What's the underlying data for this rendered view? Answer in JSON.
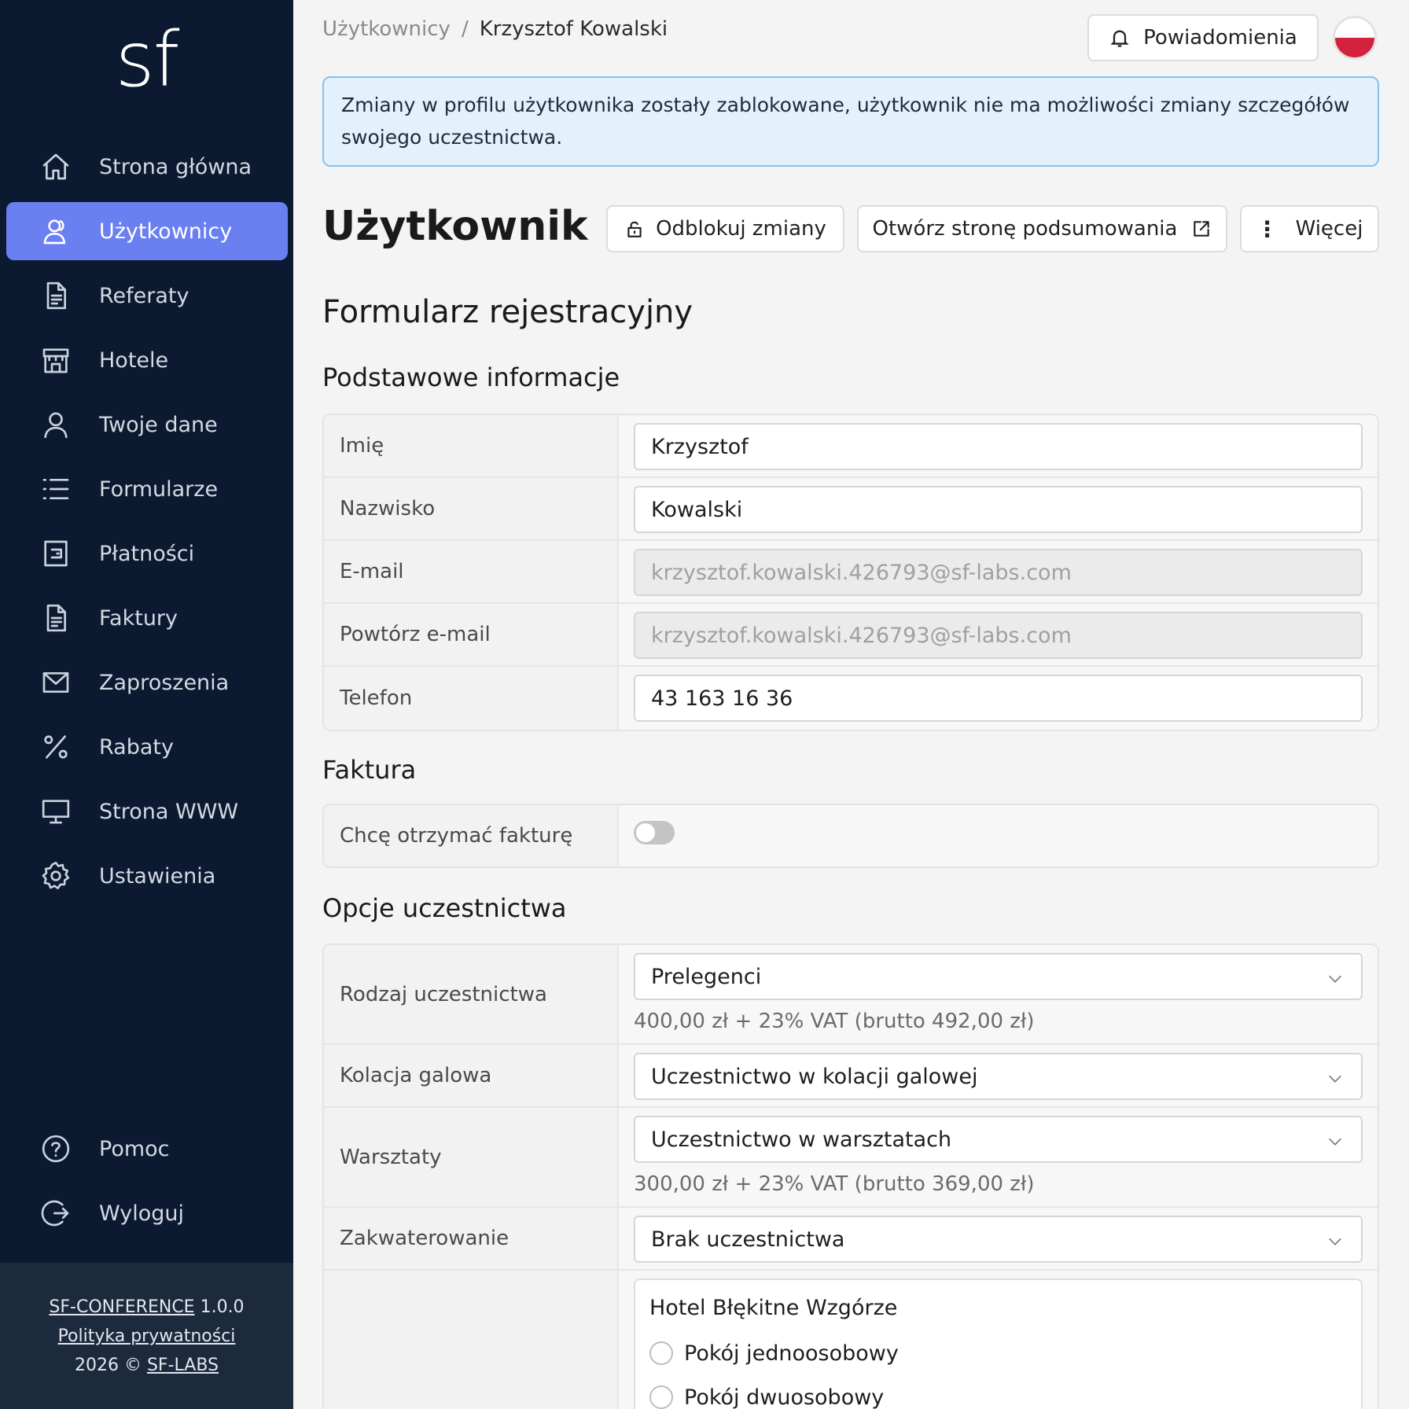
{
  "sidebar": {
    "logo": "sf",
    "items": [
      {
        "label": "Strona główna",
        "icon": "home-icon"
      },
      {
        "label": "Użytkownicy",
        "icon": "users-icon",
        "active": true
      },
      {
        "label": "Referaty",
        "icon": "document-icon"
      },
      {
        "label": "Hotele",
        "icon": "hotel-icon"
      },
      {
        "label": "Twoje dane",
        "icon": "user-icon"
      },
      {
        "label": "Formularze",
        "icon": "list-icon"
      },
      {
        "label": "Płatności",
        "icon": "wallet-icon"
      },
      {
        "label": "Faktury",
        "icon": "invoice-icon"
      },
      {
        "label": "Zaproszenia",
        "icon": "mail-icon"
      },
      {
        "label": "Rabaty",
        "icon": "percent-icon"
      },
      {
        "label": "Strona WWW",
        "icon": "monitor-icon"
      },
      {
        "label": "Ustawienia",
        "icon": "gear-icon"
      }
    ],
    "bottom": [
      {
        "label": "Pomoc",
        "icon": "help-icon"
      },
      {
        "label": "Wyloguj",
        "icon": "logout-icon"
      }
    ],
    "footer": {
      "product": "SF-CONFERENCE",
      "version": "1.0.0",
      "privacy": "Polityka prywatności",
      "copyright": "2026 ©",
      "company": "SF-LABS"
    }
  },
  "header": {
    "breadcrumb": {
      "parent": "Użytkownicy",
      "separator": "/",
      "current": "Krzysztof Kowalski"
    },
    "notifications_label": "Powiadomienia",
    "language": "pl"
  },
  "alert": "Zmiany w profilu użytkownika zostały zablokowane, użytkownik nie ma możliwości zmiany szczegółów swojego uczestnictwa.",
  "page": {
    "title": "Użytkownik",
    "unlock_label": "Odblokuj zmiany",
    "open_summary_label": "Otwórz stronę podsumowania",
    "more_label": "Więcej",
    "form_title": "Formularz rejestracyjny"
  },
  "basic": {
    "title": "Podstawowe informacje",
    "first_name": {
      "label": "Imię",
      "value": "Krzysztof"
    },
    "last_name": {
      "label": "Nazwisko",
      "value": "Kowalski"
    },
    "email": {
      "label": "E-mail",
      "value": "krzysztof.kowalski.426793@sf-labs.com"
    },
    "email_repeat": {
      "label": "Powtórz e-mail",
      "value": "krzysztof.kowalski.426793@sf-labs.com"
    },
    "phone": {
      "label": "Telefon",
      "value": "43 163 16 36"
    }
  },
  "invoice": {
    "title": "Faktura",
    "want_invoice": {
      "label": "Chcę otrzymać fakturę",
      "value": false
    }
  },
  "participation": {
    "title": "Opcje uczestnictwa",
    "type": {
      "label": "Rodzaj uczestnictwa",
      "value": "Prelegenci",
      "price": "400,00 zł + 23% VAT (brutto 492,00 zł)"
    },
    "gala": {
      "label": "Kolacja galowa",
      "value": "Uczestnictwo w kolacji galowej"
    },
    "workshops": {
      "label": "Warsztaty",
      "value": "Uczestnictwo w warsztatach",
      "price": "300,00 zł + 23% VAT (brutto 369,00 zł)"
    },
    "accommodation": {
      "label": "Zakwaterowanie",
      "value": "Brak uczestnictwa"
    },
    "hotel": {
      "name": "Hotel Błękitne Wzgórze",
      "rooms": [
        "Pokój jednoosobowy",
        "Pokój dwuosobowy"
      ]
    }
  }
}
